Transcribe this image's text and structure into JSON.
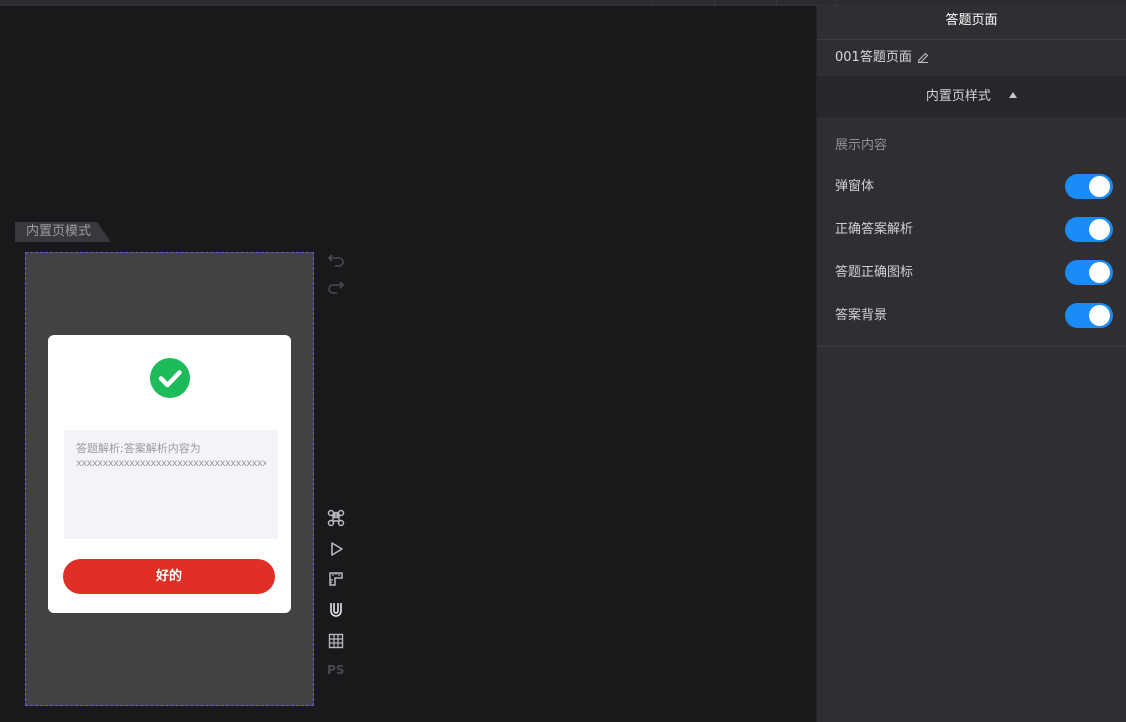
{
  "canvas": {
    "mode_tab_label": "内置页模式",
    "dialog": {
      "answer_label": "答题解析:答案解析内容为",
      "answer_text": "xxxxxxxxxxxxxxxxxxxxxxxxxxxxxxxxxxxxxx",
      "ok_label": "好的"
    },
    "tools": [
      "undo-icon",
      "redo-icon",
      "command-icon",
      "play-icon",
      "ruler-icon",
      "magnet-icon",
      "grid-icon"
    ],
    "ps_label": "PS"
  },
  "panel": {
    "title": "答题页面",
    "page_name": "001答题页面",
    "section_title": "内置页样式",
    "group_label": "展示内容",
    "toggles": [
      {
        "label": "弹窗体",
        "on": true
      },
      {
        "label": "正确答案解析",
        "on": true
      },
      {
        "label": "答题正确图标",
        "on": true
      },
      {
        "label": "答案背景",
        "on": true
      }
    ]
  },
  "colors": {
    "accent": "#1a8cf7",
    "button": "#e02f27",
    "check": "#1dbb5a",
    "selection": "#7a56d0"
  }
}
